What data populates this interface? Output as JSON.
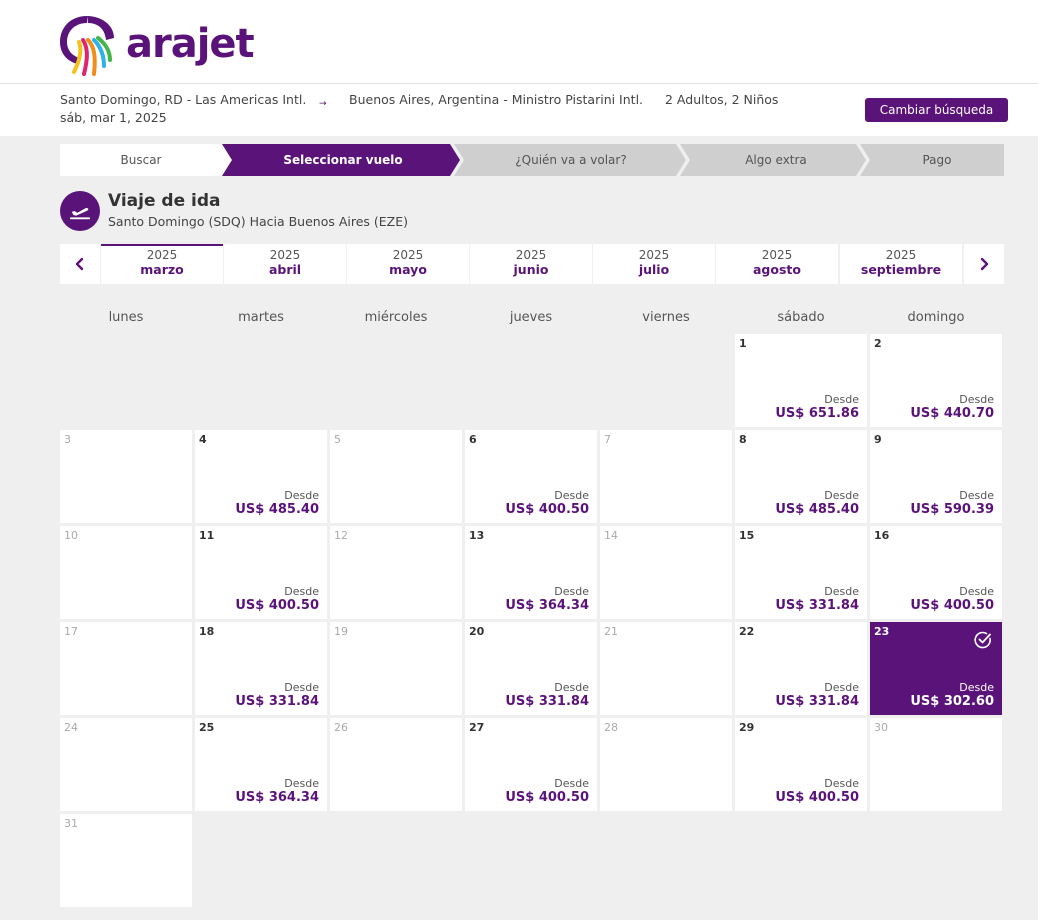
{
  "brand": {
    "name": "arajet",
    "color": "#5a1379"
  },
  "search": {
    "origin": "Santo Domingo, RD - Las Americas Intl.",
    "date": "sáb, mar 1, 2025",
    "arrow": "→",
    "destination": "Buenos Aires, Argentina - Ministro Pistarini Intl.",
    "passengers": "2 Adultos, 2 Niños",
    "change_button": "Cambiar búsqueda"
  },
  "steps": [
    {
      "label": "Buscar",
      "state": "done"
    },
    {
      "label": "Seleccionar vuelo",
      "state": "active"
    },
    {
      "label": "¿Quién va a volar?",
      "state": "pending"
    },
    {
      "label": "Algo extra",
      "state": "pending"
    },
    {
      "label": "Pago",
      "state": "pending"
    }
  ],
  "trip": {
    "icon": "plane-takeoff-icon",
    "title": "Viaje de ida",
    "route": "Santo Domingo (SDQ) Hacia Buenos Aires (EZE)"
  },
  "months": [
    {
      "year": "2025",
      "name": "marzo",
      "active": true
    },
    {
      "year": "2025",
      "name": "abril"
    },
    {
      "year": "2025",
      "name": "mayo"
    },
    {
      "year": "2025",
      "name": "junio"
    },
    {
      "year": "2025",
      "name": "julio"
    },
    {
      "year": "2025",
      "name": "agosto"
    },
    {
      "year": "2025",
      "name": "septiembre"
    }
  ],
  "weekdays": [
    "lunes",
    "martes",
    "miércoles",
    "jueves",
    "viernes",
    "sábado",
    "domingo"
  ],
  "calendar": {
    "desde_label": "Desde",
    "first_weekday_index": 5,
    "selected_day": "23",
    "days": [
      {
        "day": "1",
        "price": "US$ 651.86"
      },
      {
        "day": "2",
        "price": "US$ 440.70"
      },
      {
        "day": "3",
        "price": null
      },
      {
        "day": "4",
        "price": "US$ 485.40"
      },
      {
        "day": "5",
        "price": null
      },
      {
        "day": "6",
        "price": "US$ 400.50"
      },
      {
        "day": "7",
        "price": null
      },
      {
        "day": "8",
        "price": "US$ 485.40"
      },
      {
        "day": "9",
        "price": "US$ 590.39"
      },
      {
        "day": "10",
        "price": null
      },
      {
        "day": "11",
        "price": "US$ 400.50"
      },
      {
        "day": "12",
        "price": null
      },
      {
        "day": "13",
        "price": "US$ 364.34"
      },
      {
        "day": "14",
        "price": null
      },
      {
        "day": "15",
        "price": "US$ 331.84"
      },
      {
        "day": "16",
        "price": "US$ 400.50"
      },
      {
        "day": "17",
        "price": null
      },
      {
        "day": "18",
        "price": "US$ 331.84"
      },
      {
        "day": "19",
        "price": null
      },
      {
        "day": "20",
        "price": "US$ 331.84"
      },
      {
        "day": "21",
        "price": null
      },
      {
        "day": "22",
        "price": "US$ 331.84"
      },
      {
        "day": "23",
        "price": "US$ 302.60"
      },
      {
        "day": "24",
        "price": null
      },
      {
        "day": "25",
        "price": "US$ 364.34"
      },
      {
        "day": "26",
        "price": null
      },
      {
        "day": "27",
        "price": "US$ 400.50"
      },
      {
        "day": "28",
        "price": null
      },
      {
        "day": "29",
        "price": "US$ 400.50"
      },
      {
        "day": "30",
        "price": null
      },
      {
        "day": "31",
        "price": null
      }
    ]
  }
}
